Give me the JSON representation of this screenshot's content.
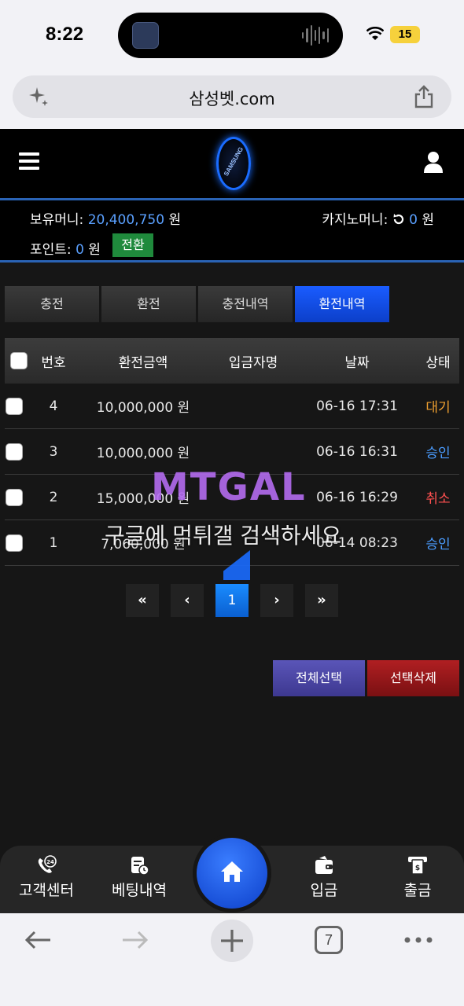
{
  "status_bar": {
    "time": "8:22",
    "battery": "15"
  },
  "browser": {
    "url": "삼성벳.com",
    "tab_count": "7"
  },
  "site": {
    "logo_text": "SAMSUNG",
    "balance_label": "보유머니:",
    "balance_value": "20,400,750",
    "won": "원",
    "casino_label": "카지노머니:",
    "casino_value": "0",
    "point_label": "포인트:",
    "point_value": "0",
    "convert_label": "전환"
  },
  "tabs": [
    {
      "label": "충전",
      "active": false
    },
    {
      "label": "환전",
      "active": false
    },
    {
      "label": "충전내역",
      "active": false
    },
    {
      "label": "환전내역",
      "active": true
    }
  ],
  "table": {
    "headers": [
      "번호",
      "환전금액",
      "입금자명",
      "날짜",
      "상태"
    ],
    "rows": [
      {
        "no": "4",
        "amount": "10,000,000 원",
        "name": "",
        "date": "06-16 17:31",
        "status": "대기",
        "status_type": "wait"
      },
      {
        "no": "3",
        "amount": "10,000,000 원",
        "name": "",
        "date": "06-16 16:31",
        "status": "승인",
        "status_type": "ok"
      },
      {
        "no": "2",
        "amount": "15,000,000 원",
        "name": "",
        "date": "06-16 16:29",
        "status": "취소",
        "status_type": "cancel"
      },
      {
        "no": "1",
        "amount": "7,060,000 원",
        "name": "",
        "date": "06-14 08:23",
        "status": "승인",
        "status_type": "ok"
      }
    ]
  },
  "pagination": {
    "first": "«",
    "prev": "‹",
    "current": "1",
    "next": "›",
    "last": "»"
  },
  "actions": {
    "select_all": "전체선택",
    "delete_selected": "선택삭제"
  },
  "watermark": {
    "logo": "MTGAL",
    "text": "구글에 먹튀갤 검색하세요"
  },
  "bottom_nav": {
    "support": "고객센터",
    "bet_history": "베팅내역",
    "deposit": "입금",
    "withdraw": "출금"
  },
  "colors": {
    "accent_blue": "#1a5cff",
    "status_wait": "#f0a030",
    "status_ok": "#4a9cff",
    "status_cancel": "#ff5050",
    "convert_green": "#1f8a3c"
  },
  "icons": [
    "sparkle-icon",
    "share-icon",
    "hamburger-icon",
    "user-icon",
    "refresh-icon",
    "support-24-icon",
    "receipt-icon",
    "home-icon",
    "wallet-icon",
    "cash-out-icon",
    "back-arrow-icon",
    "forward-arrow-icon",
    "plus-icon",
    "more-icon"
  ]
}
